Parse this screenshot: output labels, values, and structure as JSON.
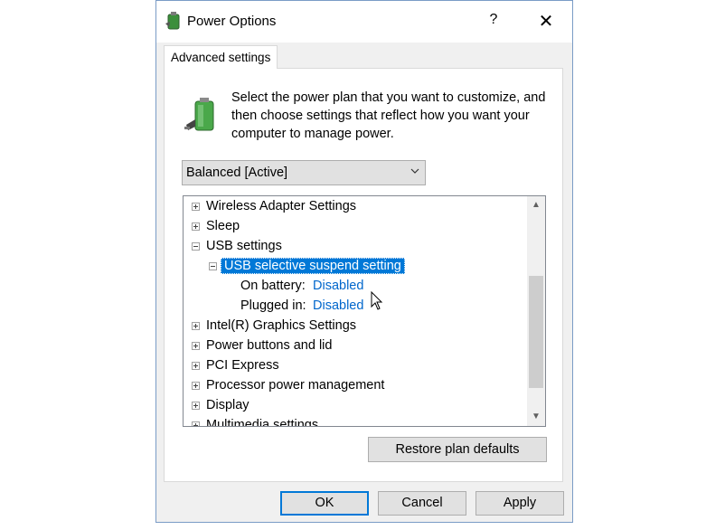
{
  "window": {
    "title": "Power Options",
    "help_label": "?",
    "close_label": "✕"
  },
  "tabs": [
    {
      "label": "Advanced settings"
    }
  ],
  "description": "Select the power plan that you want to customize, and then choose settings that reflect how you want your computer to manage power.",
  "plan_select": {
    "value": "Balanced [Active]"
  },
  "tree": {
    "items": [
      {
        "label": "Wireless Adapter Settings"
      },
      {
        "label": "Sleep"
      },
      {
        "label": "USB settings"
      },
      {
        "label": "USB selective suspend setting"
      },
      {
        "label": "On battery:",
        "value": "Disabled"
      },
      {
        "label": "Plugged in:",
        "value": "Disabled"
      },
      {
        "label": "Intel(R) Graphics Settings"
      },
      {
        "label": "Power buttons and lid"
      },
      {
        "label": "PCI Express"
      },
      {
        "label": "Processor power management"
      },
      {
        "label": "Display"
      },
      {
        "label": "Multimedia settings"
      }
    ]
  },
  "buttons": {
    "restore": "Restore plan defaults",
    "ok": "OK",
    "cancel": "Cancel",
    "apply": "Apply"
  },
  "colors": {
    "accent": "#0078d7",
    "link": "#0066cc"
  }
}
